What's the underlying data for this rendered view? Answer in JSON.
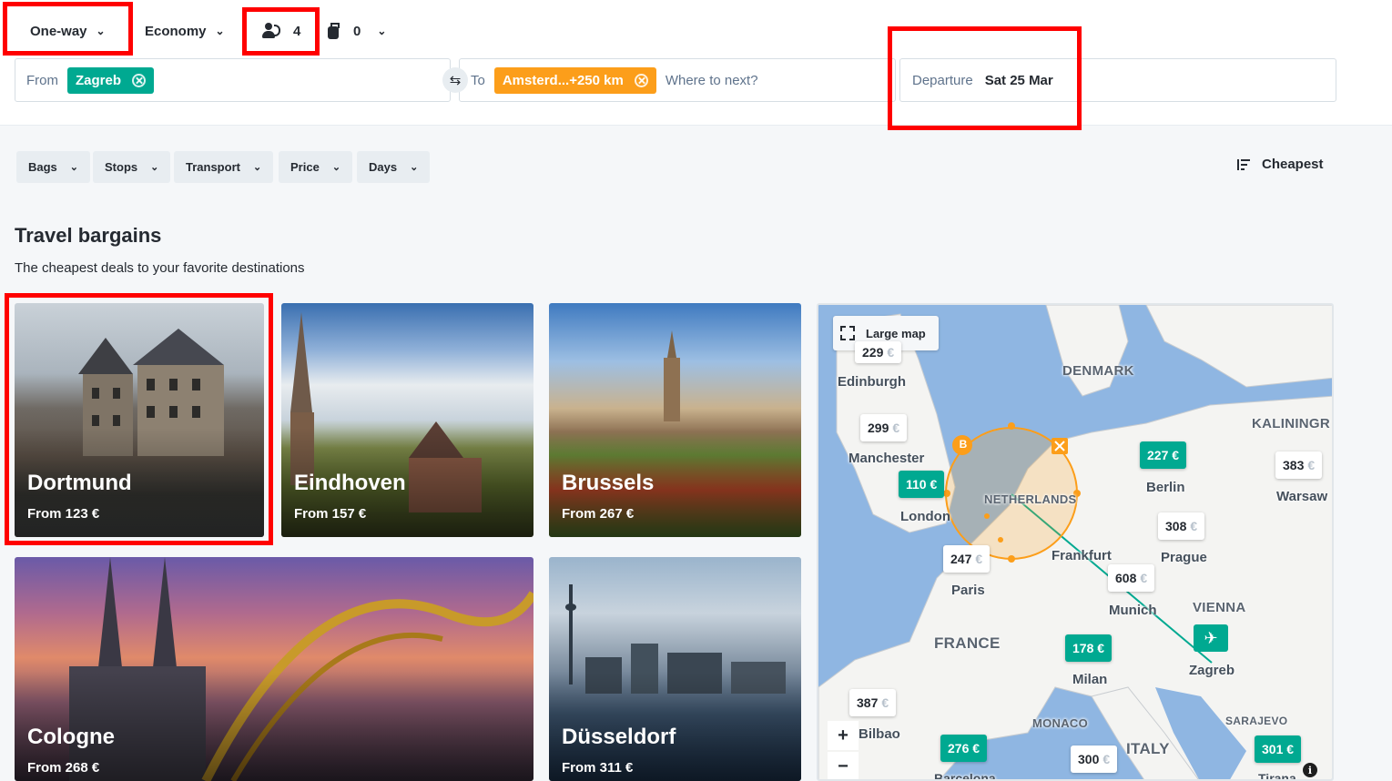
{
  "options": {
    "trip_type": "One-way",
    "cabin_class": "Economy",
    "passengers": "4",
    "bags": "0"
  },
  "search": {
    "from_label": "From",
    "from_chip": "Zagreb",
    "to_label": "To",
    "to_chip": "Amsterd...+250 km",
    "to_placeholder": "Where to next?",
    "departure_label": "Departure",
    "departure_value": "Sat 25 Mar"
  },
  "filters": [
    "Bags",
    "Stops",
    "Transport",
    "Price",
    "Days"
  ],
  "sort_label": "Cheapest",
  "section": {
    "title": "Travel bargains",
    "subtitle": "The cheapest deals to your favorite destinations"
  },
  "cards": [
    {
      "city": "Dortmund",
      "price": "From 123 €"
    },
    {
      "city": "Eindhoven",
      "price": "From 157 €"
    },
    {
      "city": "Brussels",
      "price": "From 267 €"
    },
    {
      "city": "Cologne",
      "price": "From 268 €"
    },
    {
      "city": "Düsseldorf",
      "price": "From 311 €"
    }
  ],
  "map": {
    "large_map_label": "Large map",
    "cities": [
      "Edinburgh",
      "Manchester",
      "London",
      "Berlin",
      "Warsaw",
      "Prague",
      "Paris",
      "Frankfurt",
      "Munich",
      "Milan",
      "Zagreb",
      "Bilbao",
      "Barcelona",
      "Tirana"
    ],
    "countries": [
      "DENMARK",
      "KALININGR",
      "NETHERLANDS",
      "VIENNA",
      "FRANCE",
      "MONACO",
      "SARAJEVO",
      "ITALY"
    ],
    "prices": {
      "manchester": "299",
      "london": "110 €",
      "berlin": "227 €",
      "warsaw": "383",
      "prague": "308",
      "paris": "247",
      "munich": "608",
      "milan": "178 €",
      "bilbao": "387",
      "barcelona": "276 €",
      "italy": "300",
      "tirana": "301 €"
    },
    "euro_sign": "€",
    "edinburgh_partial": "229",
    "marker_b": "B",
    "zoom_in": "+",
    "zoom_out": "−",
    "info": "i"
  }
}
